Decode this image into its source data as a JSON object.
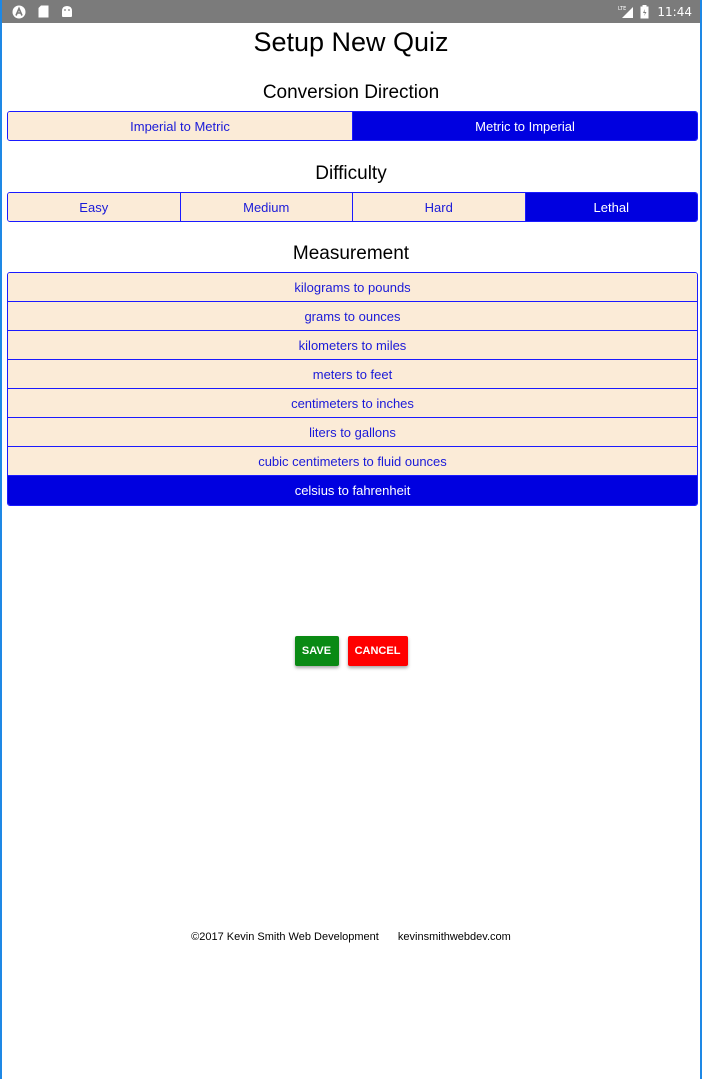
{
  "status_bar": {
    "left_icons": [
      "app-a-icon",
      "sd-card-icon",
      "android-icon"
    ],
    "right_icons": [
      "lte-signal-icon",
      "battery-icon"
    ],
    "time": "11:44"
  },
  "page": {
    "title": "Setup New Quiz"
  },
  "conversion_direction": {
    "heading": "Conversion Direction",
    "options": [
      {
        "label": "Imperial to Metric",
        "selected": false
      },
      {
        "label": "Metric to Imperial",
        "selected": true
      }
    ]
  },
  "difficulty": {
    "heading": "Difficulty",
    "options": [
      {
        "label": "Easy",
        "selected": false
      },
      {
        "label": "Medium",
        "selected": false
      },
      {
        "label": "Hard",
        "selected": false
      },
      {
        "label": "Lethal",
        "selected": true
      }
    ]
  },
  "measurement": {
    "heading": "Measurement",
    "items": [
      {
        "label": "kilograms to pounds",
        "selected": false
      },
      {
        "label": "grams to ounces",
        "selected": false
      },
      {
        "label": "kilometers to miles",
        "selected": false
      },
      {
        "label": "meters to feet",
        "selected": false
      },
      {
        "label": "centimeters to inches",
        "selected": false
      },
      {
        "label": "liters to gallons",
        "selected": false
      },
      {
        "label": "cubic centimeters to fluid ounces",
        "selected": false
      },
      {
        "label": "celsius to fahrenheit",
        "selected": true
      }
    ]
  },
  "actions": {
    "save_label": "SAVE",
    "cancel_label": "CANCEL"
  },
  "footer": {
    "copyright": "©2017 Kevin Smith Web Development",
    "website": "kevinsmithwebdev.com"
  },
  "colors": {
    "selected_bg": "#0000e0",
    "unselected_bg": "#fbebd7",
    "accent_text": "#1a1ad8",
    "save_bg": "#0a8a14",
    "cancel_bg": "#ff0000",
    "status_bar_bg": "#7b7b7b"
  }
}
